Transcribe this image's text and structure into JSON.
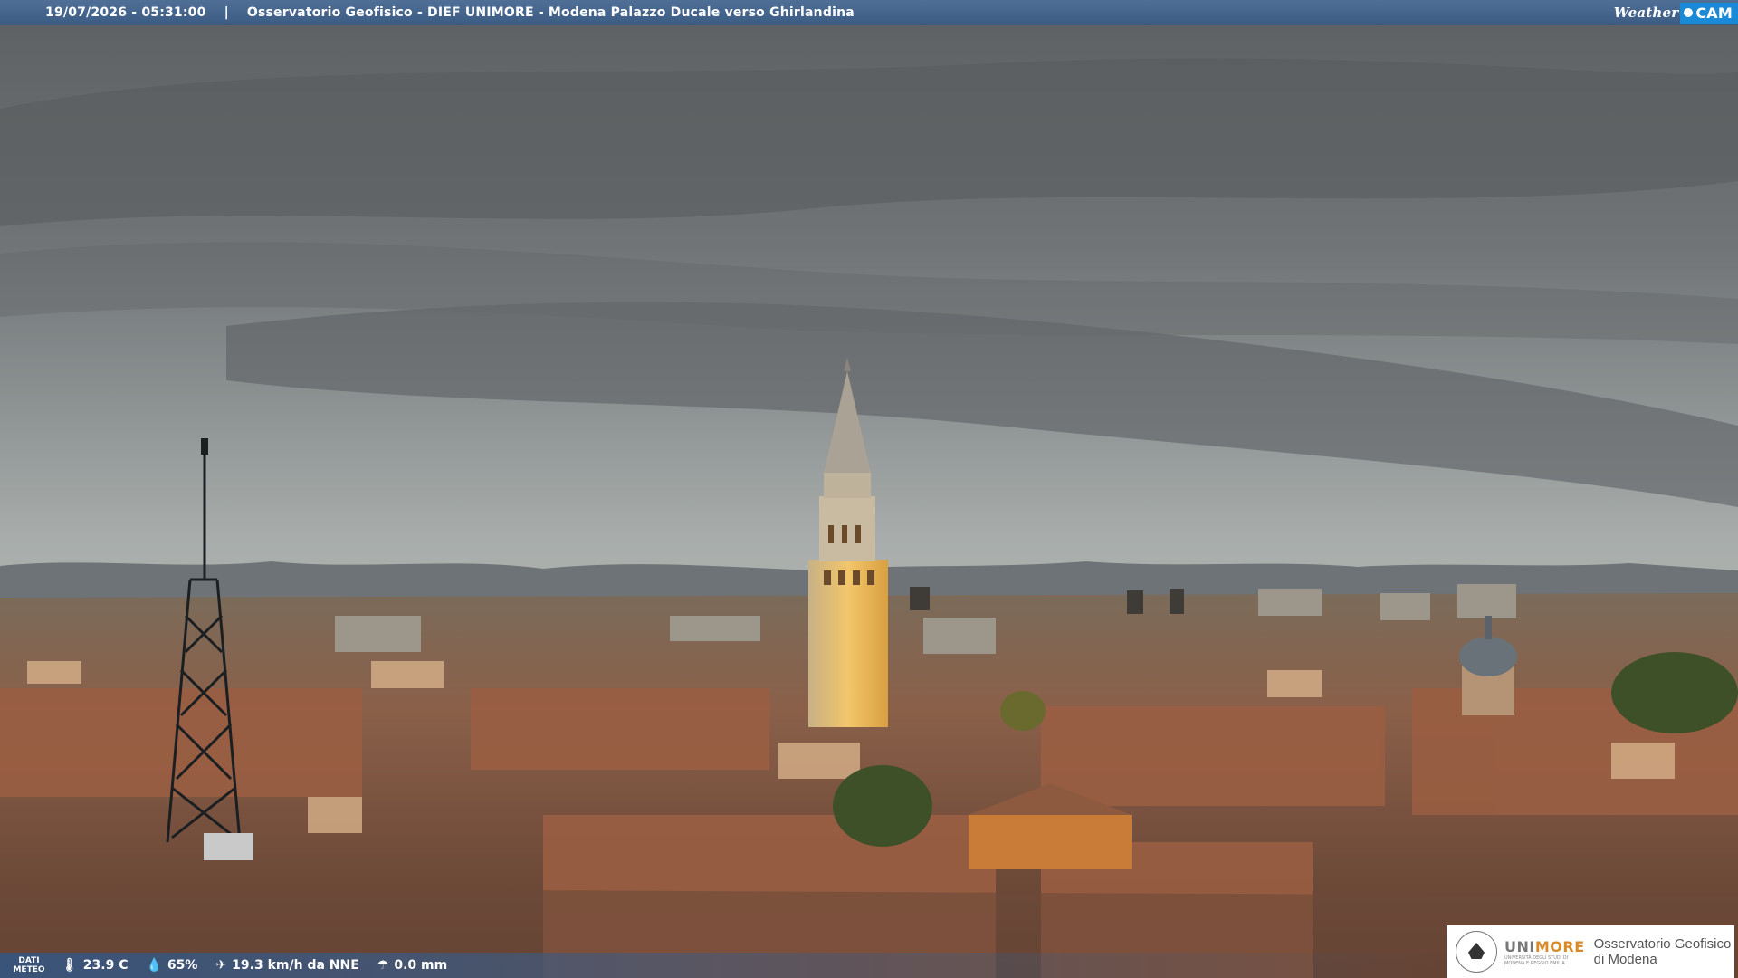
{
  "header": {
    "timestamp": "19/07/2026 - 05:31:00",
    "separator": "|",
    "location_title": "Osservatorio Geofisico - DIEF UNIMORE - Modena Palazzo Ducale verso Ghirlandina",
    "brand_weather": "Weather",
    "brand_cam": "CAM"
  },
  "weather_data": {
    "label_line1": "DATI",
    "label_line2": "METEO",
    "temperature": "23.9 C",
    "humidity": "65%",
    "wind": "19.3 km/h da NNE",
    "rain": "0.0 mm",
    "icons": [
      "thermometer-icon",
      "humidity-drop-icon",
      "wind-icon",
      "rain-icon"
    ]
  },
  "logo": {
    "uni_prefix": "UNI",
    "uni_suffix": "MORE",
    "uni_small": "UNIVERSITÀ DEGLI STUDI DI MODENA E REGGIO EMILIA",
    "observatory_line1": "Osservatorio Geofisico",
    "observatory_line2": "di Modena"
  },
  "colors": {
    "topbar": "#3c5b83",
    "brand_accent": "#1b8ad6",
    "unimore_orange": "#d98b2b"
  }
}
